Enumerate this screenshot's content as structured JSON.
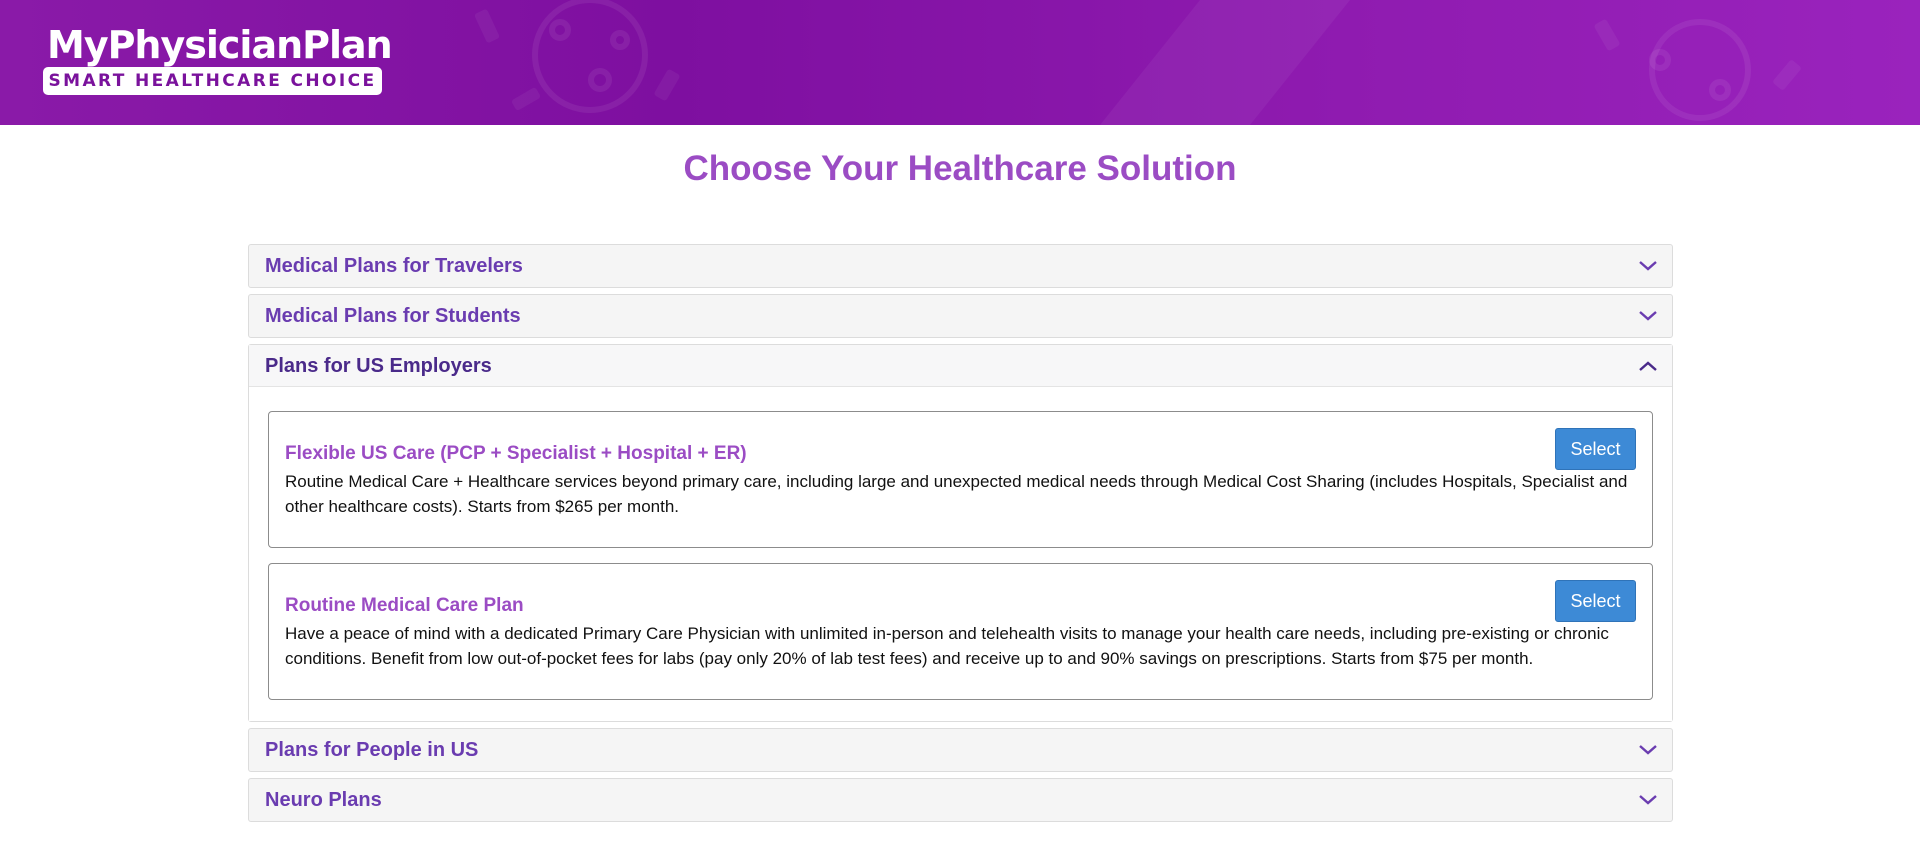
{
  "header": {
    "logo_title": "MyPhysicianPlan",
    "logo_tagline": "SMART HEALTHCARE CHOICE",
    "banner_color": "#8a1aa8"
  },
  "page_title": "Choose Your Healthcare Solution",
  "accordion": [
    {
      "title": "Medical Plans for Travelers",
      "expanded": false,
      "icon": "chevron-down-icon"
    },
    {
      "title": "Medical Plans for Students",
      "expanded": false,
      "icon": "chevron-down-icon"
    },
    {
      "title": "Plans for US Employers",
      "expanded": true,
      "icon": "chevron-up-icon",
      "plans": [
        {
          "name": "Flexible US Care (PCP + Specialist + Hospital + ER)",
          "description": "Routine Medical Care + Healthcare services beyond primary care, including large and unexpected medical needs through Medical Cost Sharing (includes Hospitals, Specialist and other healthcare costs). Starts from $265 per month.",
          "button": "Select"
        },
        {
          "name": "Routine Medical Care Plan",
          "description": "Have a peace of mind with a dedicated Primary Care Physician with unlimited in-person and telehealth visits to manage your health care needs, including pre-existing or chronic conditions. Benefit from low out-of-pocket fees for labs (pay only 20% of lab test fees) and receive up to and 90% savings on prescriptions. Starts from $75 per month.",
          "button": "Select"
        }
      ]
    },
    {
      "title": "Plans for People in US",
      "expanded": false,
      "icon": "chevron-down-icon"
    },
    {
      "title": "Neuro Plans",
      "expanded": false,
      "icon": "chevron-down-icon"
    }
  ],
  "colors": {
    "title_purple": "#9b4cc4",
    "accordion_title": "#6a3cb0",
    "button_blue": "#3d8ad6"
  }
}
